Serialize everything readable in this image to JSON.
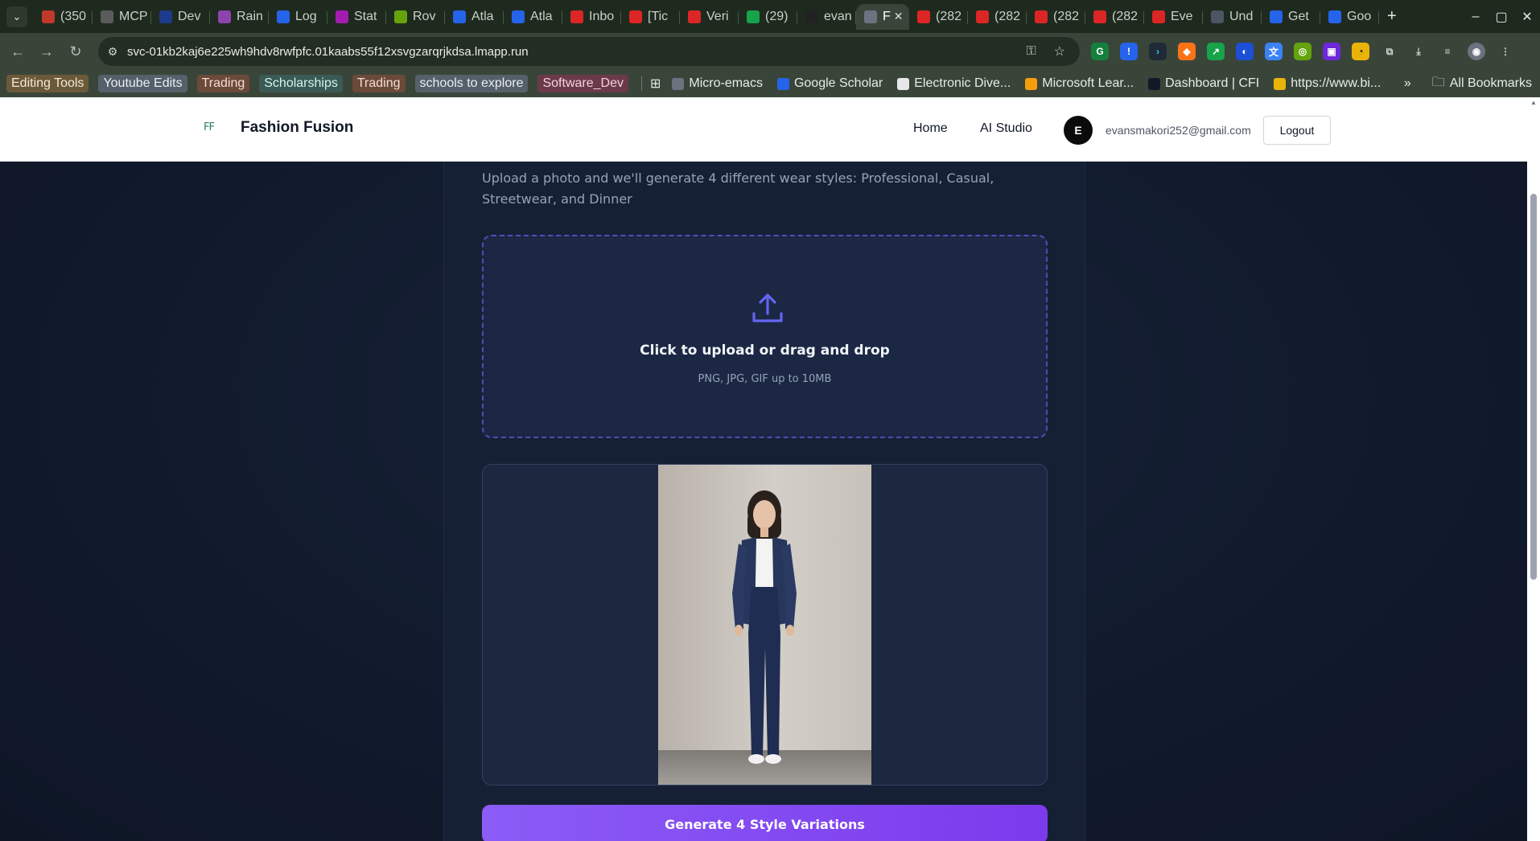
{
  "browser": {
    "tabs": [
      {
        "label": "(350",
        "icon": "youtube-live-icon",
        "color": "#c0392b"
      },
      {
        "label": "MCP",
        "icon": "openai-icon",
        "color": "#5b5b5b"
      },
      {
        "label": "Dev",
        "icon": "dev-icon",
        "color": "#1e3a8a"
      },
      {
        "label": "Rain",
        "icon": "rain-icon",
        "color": "#8e44ad"
      },
      {
        "label": "Log",
        "icon": "v-icon",
        "color": "#2563eb"
      },
      {
        "label": "Stat",
        "icon": "stat-icon",
        "color": "#a21caf"
      },
      {
        "label": "Rov",
        "icon": "rov-icon",
        "color": "#65a30d"
      },
      {
        "label": "Atla",
        "icon": "atlassian-icon",
        "color": "#2563eb"
      },
      {
        "label": "Atla",
        "icon": "atlassian-icon",
        "color": "#2563eb"
      },
      {
        "label": "Inbo",
        "icon": "gmail-icon",
        "color": "#dc2626"
      },
      {
        "label": "[Tic",
        "icon": "gmail-icon",
        "color": "#dc2626"
      },
      {
        "label": "Veri",
        "icon": "gmail-icon",
        "color": "#dc2626"
      },
      {
        "label": "(29)",
        "icon": "whatsapp-icon",
        "color": "#16a34a"
      },
      {
        "label": "evan",
        "icon": "github-icon",
        "color": "#222222"
      },
      {
        "label": "F",
        "icon": "globe-icon",
        "color": "#6b7280",
        "active": true
      },
      {
        "label": "(282",
        "icon": "youtube-icon",
        "color": "#dc2626"
      },
      {
        "label": "(282",
        "icon": "youtube-icon",
        "color": "#dc2626"
      },
      {
        "label": "(282",
        "icon": "youtube-icon",
        "color": "#dc2626"
      },
      {
        "label": "(282",
        "icon": "youtube-icon",
        "color": "#dc2626"
      },
      {
        "label": "Eve",
        "icon": "youtube-icon",
        "color": "#dc2626"
      },
      {
        "label": "Und",
        "icon": "und-icon",
        "color": "#4b5563"
      },
      {
        "label": "Get",
        "icon": "atlassian-icon",
        "color": "#2563eb"
      },
      {
        "label": "Goo",
        "icon": "atlassian-icon",
        "color": "#2563eb"
      }
    ],
    "url": "svc-01kb2kaj6e225wh9hdv8rwfpfc.01kaabs55f12xsvgzarqrjkdsa.lmapp.run",
    "bookmark_chips": [
      {
        "label": "Editing Tools",
        "bg": "#6b5a3a",
        "fg": "#f3e9d2"
      },
      {
        "label": "Youtube Edits",
        "bg": "#55606b",
        "fg": "#e8eef3"
      },
      {
        "label": "Trading",
        "bg": "#6b4a3a",
        "fg": "#f3ddd2"
      },
      {
        "label": "Scholarships",
        "bg": "#3a5a55",
        "fg": "#d2f3ee"
      },
      {
        "label": "Trading",
        "bg": "#6b4a3a",
        "fg": "#f3ddd2"
      },
      {
        "label": "schools to explore",
        "bg": "#55606b",
        "fg": "#e8eef3"
      },
      {
        "label": "Software_Dev",
        "bg": "#6b3a4a",
        "fg": "#f3d2dd"
      }
    ],
    "bookmark_links": [
      {
        "label": "Micro-emacs",
        "color": "#6b7280"
      },
      {
        "label": "Google Scholar",
        "color": "#2563eb"
      },
      {
        "label": "Electronic Dive...",
        "color": "#e5e7eb"
      },
      {
        "label": "Microsoft Lear...",
        "color": "#f59e0b"
      },
      {
        "label": "Dashboard | CFI",
        "color": "#111827"
      },
      {
        "label": "https://www.bi...",
        "color": "#eab308"
      }
    ],
    "all_bookmarks": "All Bookmarks"
  },
  "header": {
    "logo_text": "FF",
    "brand": "Fashion Fusion",
    "nav": [
      "Home",
      "AI Studio"
    ],
    "avatar_initial": "E",
    "email": "evansmakori252@gmail.com",
    "logout": "Logout"
  },
  "main": {
    "subtitle": "Upload a photo and we'll generate 4 different wear styles: Professional, Casual, Streetwear, and Dinner",
    "upload_title": "Click to upload or drag and drop",
    "upload_hint": "PNG, JPG, GIF up to 10MB",
    "generate_label": "Generate 4 Style Variations"
  },
  "colors": {
    "accent": "#7c3aed",
    "upload_icon": "#6366f1",
    "page_bg": "#111a2c"
  }
}
